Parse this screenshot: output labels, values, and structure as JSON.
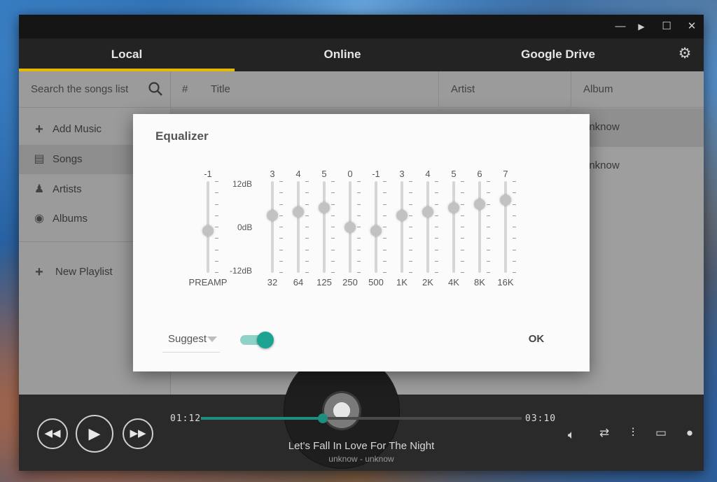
{
  "window": {
    "controls": [
      "—",
      "▶",
      "☐",
      "✕"
    ]
  },
  "tabs": [
    {
      "label": "Local",
      "active": true
    },
    {
      "label": "Online",
      "active": false
    },
    {
      "label": "Google Drive",
      "active": false
    }
  ],
  "sidebar": {
    "search_placeholder": "Search the songs list",
    "items": [
      {
        "label": "Add Music",
        "icon": "plus-icon"
      },
      {
        "label": "Songs",
        "icon": "music-list-icon",
        "active": true
      },
      {
        "label": "Artists",
        "icon": "artist-icon"
      },
      {
        "label": "Albums",
        "icon": "album-icon"
      }
    ],
    "new_playlist": "New Playlist"
  },
  "table": {
    "headers": {
      "num": "#",
      "title": "Title",
      "artist": "Artist",
      "album": "Album"
    },
    "rows": [
      {
        "album": "unknow"
      },
      {
        "album": "unknow"
      }
    ]
  },
  "player": {
    "elapsed": "01:12",
    "total": "03:10",
    "progress": 0.38,
    "song_title": "Let's Fall In Love For The Night",
    "song_sub": "unknow - unknow"
  },
  "equalizer": {
    "title": "Equalizer",
    "scale": {
      "top": "12dB",
      "mid": "0dB",
      "bottom": "-12dB"
    },
    "preamp": {
      "label": "PREAMP",
      "value": "-1"
    },
    "bands": [
      {
        "label": "32",
        "value": "3"
      },
      {
        "label": "64",
        "value": "4"
      },
      {
        "label": "125",
        "value": "5"
      },
      {
        "label": "250",
        "value": "0"
      },
      {
        "label": "500",
        "value": "-1"
      },
      {
        "label": "1K",
        "value": "3"
      },
      {
        "label": "2K",
        "value": "4"
      },
      {
        "label": "4K",
        "value": "5"
      },
      {
        "label": "8K",
        "value": "6"
      },
      {
        "label": "16K",
        "value": "7"
      }
    ],
    "preset": "Suggest",
    "enabled": true,
    "ok_label": "OK"
  }
}
